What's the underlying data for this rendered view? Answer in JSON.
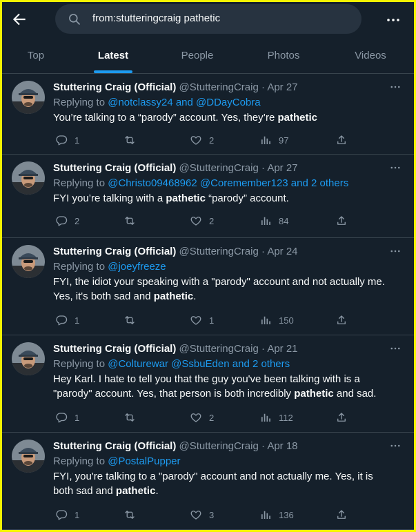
{
  "search": {
    "query": "from:stutteringcraig pathetic"
  },
  "tabs": [
    "Top",
    "Latest",
    "People",
    "Photos",
    "Videos"
  ],
  "active_tab": "Latest",
  "colors": {
    "background": "#15202b",
    "accent": "#1d9bf0",
    "muted": "#8b98a5",
    "divider": "#38444d",
    "frame": "#f4f400"
  },
  "icons": [
    "back-arrow-icon",
    "search-icon",
    "more-icon",
    "reply-icon",
    "retweet-icon",
    "like-icon",
    "views-icon",
    "share-icon"
  ],
  "tweets": [
    {
      "name": "Stuttering Craig (Official)",
      "handle": "@StutteringCraig",
      "sep": "·",
      "date": "Apr 27",
      "replying_prefix": "Replying to",
      "replying_to": "@notclassy24 and @DDayCobra",
      "body_lines": [
        [
          {
            "t": "You’re talking to a “parody” account. Yes, they’re "
          },
          {
            "t": "pathetic",
            "b": true
          }
        ]
      ],
      "replies": "1",
      "retweets": "",
      "likes": "2",
      "views": "97"
    },
    {
      "name": "Stuttering Craig (Official)",
      "handle": "@StutteringCraig",
      "sep": "·",
      "date": "Apr 27",
      "replying_prefix": "Replying to",
      "replying_to": "@Christo09468962 @Coremember123 and 2 others",
      "body_lines": [
        [
          {
            "t": "FYI you’re talking with a "
          },
          {
            "t": "pathetic",
            "b": true
          },
          {
            "t": " “parody” account."
          }
        ]
      ],
      "replies": "2",
      "retweets": "",
      "likes": "2",
      "views": "84"
    },
    {
      "name": "Stuttering Craig (Official)",
      "handle": "@StutteringCraig",
      "sep": "·",
      "date": "Apr 24",
      "replying_prefix": "Replying to",
      "replying_to": "@joeyfreeze",
      "body_lines": [
        [
          {
            "t": "FYI, the idiot your speaking with a \"parody\" account and not actually me."
          }
        ],
        [
          {
            "t": "Yes, it's both sad and "
          },
          {
            "t": "pathetic",
            "b": true
          },
          {
            "t": "."
          }
        ]
      ],
      "replies": "1",
      "retweets": "",
      "likes": "1",
      "views": "150"
    },
    {
      "name": "Stuttering Craig (Official)",
      "handle": "@StutteringCraig",
      "sep": "·",
      "date": "Apr 21",
      "replying_prefix": "Replying to",
      "replying_to": "@Colturewar @SsbuEden and 2 others",
      "body_lines": [
        [
          {
            "t": "Hey Karl. I hate to tell you that the guy you've been talking with is a"
          }
        ],
        [
          {
            "t": "\"parody\" account. Yes, that person is both incredibly "
          },
          {
            "t": "pathetic",
            "b": true
          },
          {
            "t": " and sad."
          }
        ]
      ],
      "replies": "1",
      "retweets": "",
      "likes": "2",
      "views": "112"
    },
    {
      "name": "Stuttering Craig (Official)",
      "handle": "@StutteringCraig",
      "sep": "·",
      "date": "Apr 18",
      "replying_prefix": "Replying to",
      "replying_to": "@PostalPupper",
      "body_lines": [
        [
          {
            "t": "FYI, you're talking to a \"parody\" account and not actually me. Yes, it is"
          }
        ],
        [
          {
            "t": "both sad and "
          },
          {
            "t": "pathetic",
            "b": true
          },
          {
            "t": "."
          }
        ]
      ],
      "replies": "1",
      "retweets": "",
      "likes": "3",
      "views": "136"
    }
  ]
}
